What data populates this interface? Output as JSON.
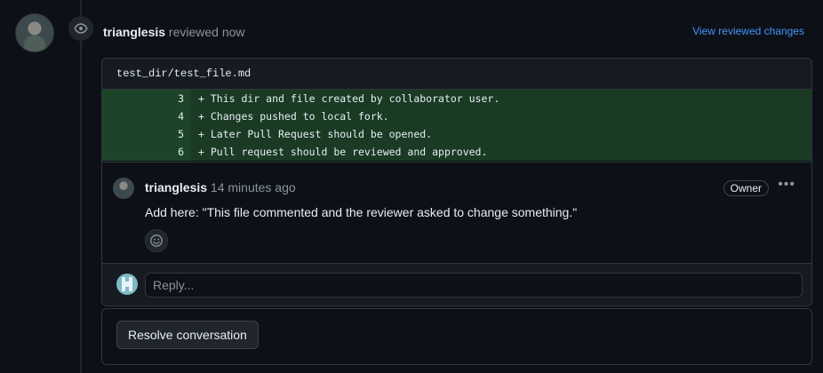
{
  "review": {
    "username": "trianglesis",
    "action_text": "reviewed now",
    "view_link": "View reviewed changes"
  },
  "file": {
    "path": "test_dir/test_file.md"
  },
  "diff": {
    "lines": [
      {
        "num": "3",
        "text": "+ This dir and file created by collaborator user."
      },
      {
        "num": "4",
        "text": "+ Changes pushed to local fork."
      },
      {
        "num": "5",
        "text": "+ Later Pull Request should be opened."
      },
      {
        "num": "6",
        "text": "+ Pull request should be reviewed and approved."
      }
    ]
  },
  "comment": {
    "username": "trianglesis",
    "time": "14 minutes ago",
    "badge": "Owner",
    "body": "Add here: \"This file commented and the reviewer asked to change something.\""
  },
  "reply": {
    "placeholder": "Reply..."
  },
  "resolve": {
    "label": "Resolve conversation"
  },
  "colors": {
    "background": "#0d1117",
    "link": "#4493f8",
    "diff_add": "#1a3a24"
  },
  "icons": [
    "eye-icon",
    "smiley-icon",
    "kebab-icon",
    "avatar"
  ]
}
